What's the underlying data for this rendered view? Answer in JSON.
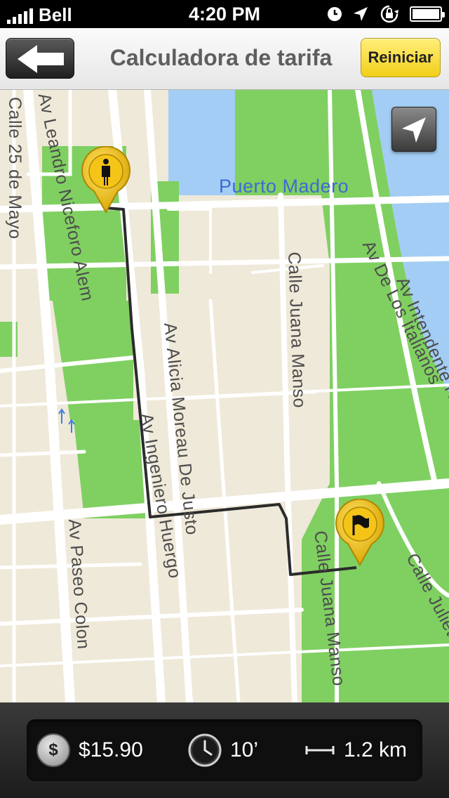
{
  "status_bar": {
    "carrier": "Bell",
    "time": "4:20 PM"
  },
  "nav": {
    "title": "Calculadora de tarifa",
    "reset_label": "Reiniciar"
  },
  "map": {
    "labels": {
      "puerto_madero": "Puerto Madero",
      "calle_25_mayo": "Calle 25 de Mayo",
      "leandro_alem": "Av Leandro Niceforo Alem",
      "alicia_moreau": "Av Alicia Moreau De Justo",
      "ingeniero_huergo": "Av Ingeniero Huergo",
      "juana_manso_upper": "Calle Juana Manso",
      "juana_manso_lower": "Calle Juana Manso",
      "de_los_italianos": "Av De Los Italianos",
      "intendente_hernan": "Av Intendente Herna",
      "paseo_colon": "Av Paseo Colon",
      "julieta_lanteri": "Calle Julieta Lant"
    }
  },
  "trip": {
    "fare": "$15.90",
    "duration": "10’",
    "distance": "1.2 km",
    "coin_symbol": "$"
  },
  "colors": {
    "park": "#7fd061",
    "water": "#a3cdf4",
    "land": "#efe9d9",
    "road": "#ffffff",
    "route": "#2b2b2b",
    "pin": "#f1c10e",
    "reset_button": "#f2cf19"
  }
}
